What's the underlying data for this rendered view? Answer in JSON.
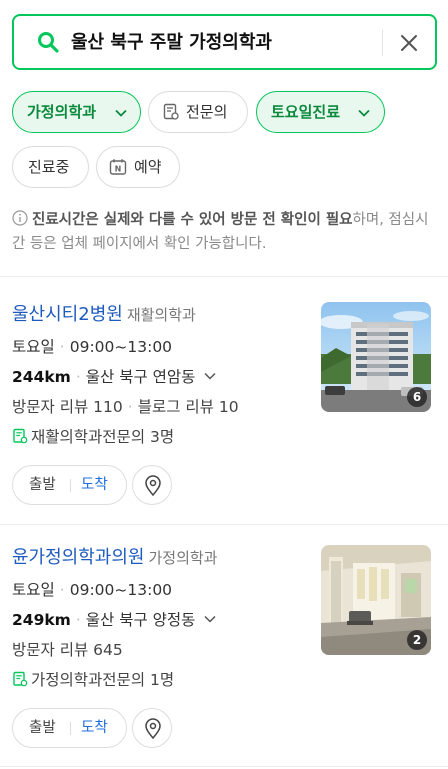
{
  "search": {
    "query": "울산 북구 주말 가정의학과"
  },
  "filters": [
    {
      "label": "가정의학과",
      "active": true,
      "icon": "chevron-down-icon"
    },
    {
      "label": "전문의",
      "active": false,
      "icon": "doctor-cert-icon"
    },
    {
      "label": "토요일진료",
      "active": true,
      "icon": "chevron-down-icon"
    },
    {
      "label": "진료중",
      "active": false
    },
    {
      "label": "예약",
      "active": false,
      "icon": "naver-reservation-icon"
    }
  ],
  "notice": {
    "bold": "진료시간은 실제와 다를 수 있어 방문 전 확인이 필요",
    "rest": "하며, 점심시간 등은 업체 페이지에서 확인 가능합니다."
  },
  "results": [
    {
      "name": "울산시티2병원",
      "category": "재활의학과",
      "day": "토요일",
      "hours": "09:00~13:00",
      "distance": "244km",
      "area": "울산 북구 연암동",
      "visitor_reviews": "방문자 리뷰 110",
      "blog_reviews": "블로그 리뷰 10",
      "specialists": "재활의학과전문의 3명",
      "photo_count": "6",
      "depart_label": "출발",
      "arrive_label": "도착"
    },
    {
      "name": "윤가정의학과의원",
      "category": "가정의학과",
      "day": "토요일",
      "hours": "09:00~13:00",
      "distance": "249km",
      "area": "울산 북구 양정동",
      "visitor_reviews": "방문자 리뷰 645",
      "specialists": "가정의학과전문의 1명",
      "photo_count": "2",
      "depart_label": "출발",
      "arrive_label": "도착"
    }
  ],
  "colors": {
    "accent": "#03c75a",
    "link": "#1f5bbf",
    "arrive": "#1f6fe0"
  }
}
